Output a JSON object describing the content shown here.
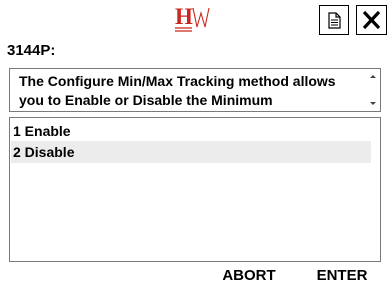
{
  "header": {
    "logo_icon": "hw-logo-icon",
    "logo_color": "#c8281e",
    "note_button_icon": "document-icon",
    "close_button_icon": "close-icon"
  },
  "device": {
    "title": "3144P:"
  },
  "description": {
    "text": "The Configure Min/Max Tracking method allows you to Enable or Disable the Minimum"
  },
  "options": [
    {
      "label": "1 Enable"
    },
    {
      "label": "2 Disable"
    }
  ],
  "footer": {
    "abort_label": "ABORT",
    "enter_label": "ENTER"
  }
}
